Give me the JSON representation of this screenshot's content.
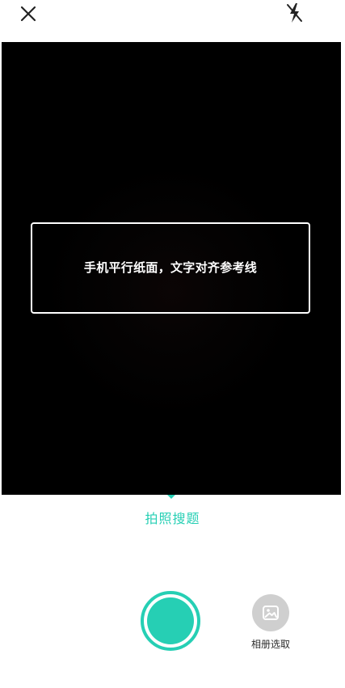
{
  "top_bar": {
    "close_icon": "close-icon",
    "flash_icon": "flash-off-icon"
  },
  "viewfinder": {
    "guide_text": "手机平行纸面，文字对齐参考线"
  },
  "mode": {
    "label": "拍照搜题",
    "accent_color": "#26cfb4"
  },
  "capture": {
    "shutter_icon": "shutter-button"
  },
  "album": {
    "icon": "image-icon",
    "label": "相册选取"
  }
}
